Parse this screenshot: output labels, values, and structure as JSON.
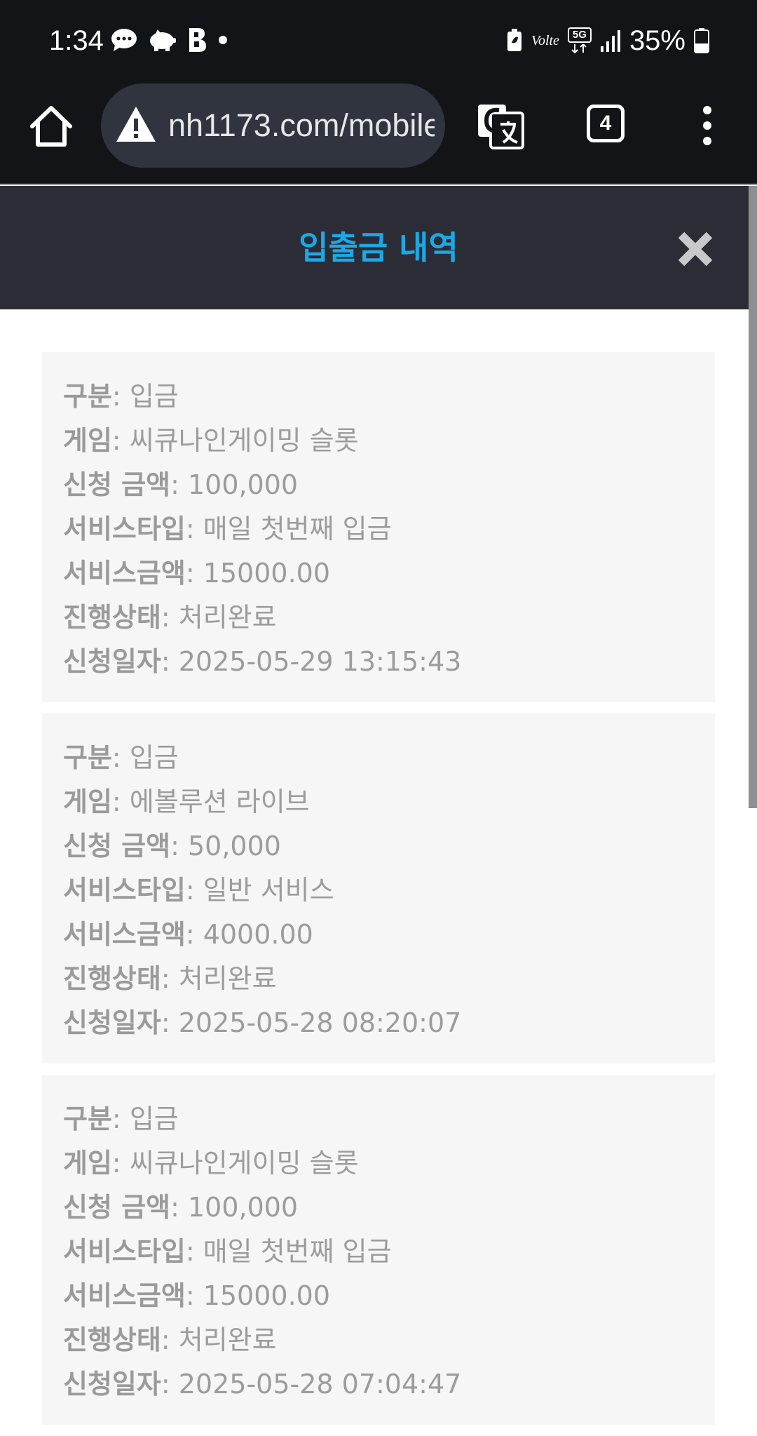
{
  "status": {
    "time": "1:34",
    "battery": "35%",
    "network_badge": "5G",
    "volte": "Volte",
    "left_icons": [
      "chat-bubble-icon",
      "piggy-bank-icon",
      "b-app-icon",
      "dot-icon"
    ]
  },
  "browser": {
    "url": "nh1173.com/mobile",
    "tab_count": "4"
  },
  "modal": {
    "title": "입출금 내역",
    "labels": {
      "type": "구분",
      "game": "게임",
      "amount": "신청 금액",
      "service_type": "서비스타입",
      "service_amount": "서비스금액",
      "status": "진행상태",
      "date": "신청일자"
    },
    "records": [
      {
        "type": "입금",
        "game": "씨큐나인게이밍 슬롯",
        "amount": "100,000",
        "service_type": "매일 첫번째 입금",
        "service_amount": "15000.00",
        "status": "처리완료",
        "date": "2025-05-29 13:15:43"
      },
      {
        "type": "입금",
        "game": "에볼루션 라이브",
        "amount": "50,000",
        "service_type": "일반 서비스",
        "service_amount": "4000.00",
        "status": "처리완료",
        "date": "2025-05-28 08:20:07"
      },
      {
        "type": "입금",
        "game": "씨큐나인게이밍 슬롯",
        "amount": "100,000",
        "service_type": "매일 첫번째 입금",
        "service_amount": "15000.00",
        "status": "처리완료",
        "date": "2025-05-28 07:04:47"
      }
    ]
  },
  "colors": {
    "title": "#1ba9e6",
    "header_bg": "#2b2c36",
    "card_bg": "#f6f6f6",
    "text": "#9c9c9c"
  }
}
